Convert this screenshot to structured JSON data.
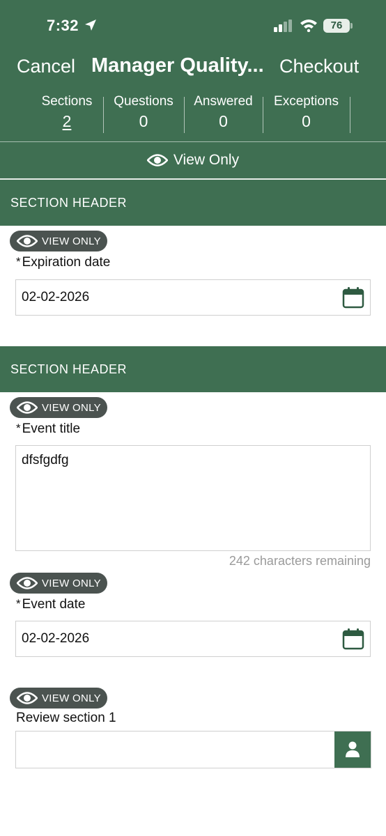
{
  "status_bar": {
    "time": "7:32",
    "battery": "76"
  },
  "nav": {
    "cancel": "Cancel",
    "title": "Manager Quality...",
    "checkout": "Checkout"
  },
  "stats": [
    {
      "label": "Sections",
      "value": "2"
    },
    {
      "label": "Questions",
      "value": "0"
    },
    {
      "label": "Answered",
      "value": "0"
    },
    {
      "label": "Exceptions",
      "value": "0"
    }
  ],
  "view_only_bar": "View Only",
  "badge_text": "VIEW ONLY",
  "sections": [
    {
      "header": "SECTION HEADER",
      "fields": [
        {
          "label": "Expiration date",
          "required": "*",
          "value": "02-02-2026"
        }
      ]
    },
    {
      "header": "SECTION HEADER",
      "fields": [
        {
          "label": "Event title",
          "required": "*",
          "value": "dfsfgdfg",
          "helper": "242 characters remaining"
        },
        {
          "label": "Event date",
          "required": "*",
          "value": "02-02-2026"
        },
        {
          "label": "Review section 1",
          "value": ""
        }
      ]
    }
  ],
  "colors": {
    "primary": "#3f6f52",
    "badge": "#4b5350",
    "field_border": "#cfcfcf"
  }
}
